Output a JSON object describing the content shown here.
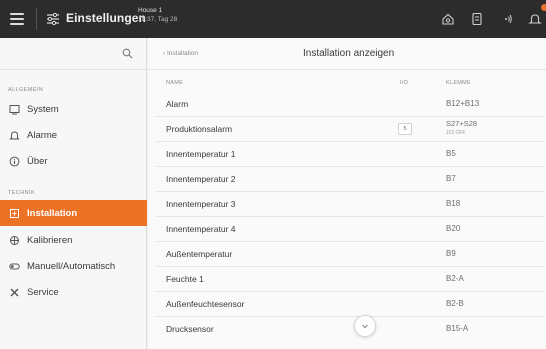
{
  "topbar": {
    "title": "Einstellungen",
    "house_name": "House 1",
    "house_time": "18:37, Tag 28",
    "icons": [
      "menu-icon",
      "settings-sliders-icon",
      "home-icon",
      "fan-icon",
      "signal-icon",
      "alarm-bell-icon"
    ]
  },
  "sidebar": {
    "sections": [
      {
        "title": "ALLGEMEIN",
        "items": [
          {
            "label": "System",
            "icon": "monitor-icon"
          },
          {
            "label": "Alarme",
            "icon": "bell-icon"
          },
          {
            "label": "Über",
            "icon": "info-icon"
          }
        ]
      },
      {
        "title": "TECHNIK",
        "items": [
          {
            "label": "Installation",
            "icon": "installation-icon",
            "active": true
          },
          {
            "label": "Kalibrieren",
            "icon": "calibrate-icon"
          },
          {
            "label": "Manuell/Automatisch",
            "icon": "toggle-icon"
          },
          {
            "label": "Service",
            "icon": "tools-icon"
          }
        ]
      }
    ]
  },
  "main": {
    "breadcrumb": "‹ Installation",
    "title": "Installation anzeigen",
    "columns": {
      "name": "NAME",
      "io": "I/O",
      "terminal": "KLEMME"
    },
    "rows": [
      {
        "name": "Alarm",
        "io": "",
        "terminal": "B12+B13",
        "sub": ""
      },
      {
        "name": "Produktionsalarm",
        "io": "5",
        "terminal": "S27+S28",
        "sub": "J13 OFF"
      },
      {
        "name": "Innentemperatur 1",
        "io": "",
        "terminal": "B5",
        "sub": ""
      },
      {
        "name": "Innentemperatur 2",
        "io": "",
        "terminal": "B7",
        "sub": ""
      },
      {
        "name": "Innentemperatur 3",
        "io": "",
        "terminal": "B18",
        "sub": ""
      },
      {
        "name": "Innentemperatur 4",
        "io": "",
        "terminal": "B20",
        "sub": ""
      },
      {
        "name": "Außentemperatur",
        "io": "",
        "terminal": "B9",
        "sub": ""
      },
      {
        "name": "Feuchte 1",
        "io": "",
        "terminal": "B2-A",
        "sub": ""
      },
      {
        "name": "Außenfeuchtesensor",
        "io": "",
        "terminal": "B2-B",
        "sub": ""
      },
      {
        "name": "Drucksensor",
        "io": "",
        "terminal": "B15-A",
        "sub": ""
      }
    ]
  },
  "colors": {
    "accent": "#ec7326",
    "topbar": "#2c2c2c"
  }
}
